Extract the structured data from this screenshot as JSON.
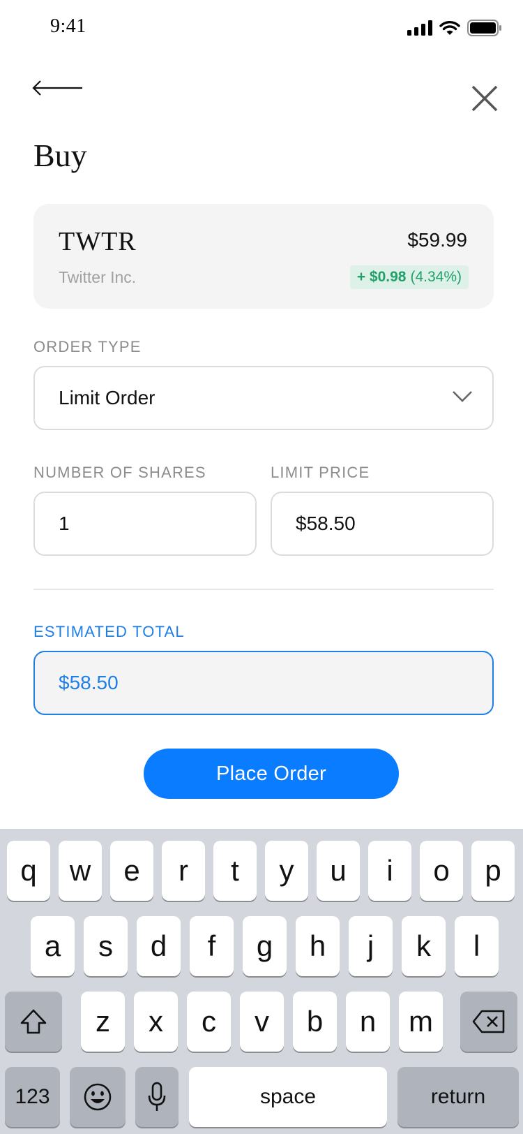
{
  "status_bar": {
    "time": "9:41"
  },
  "header": {
    "title": "Buy"
  },
  "stock": {
    "ticker": "TWTR",
    "company": "Twitter Inc.",
    "price": "$59.99",
    "change_amount": "+ $0.98",
    "change_percent": "(4.34%)"
  },
  "order_type": {
    "label": "ORDER TYPE",
    "value": "Limit Order"
  },
  "shares": {
    "label": "NUMBER OF SHARES",
    "value": "1"
  },
  "limit_price": {
    "label": "LIMIT PRICE",
    "value": "$58.50"
  },
  "estimated_total": {
    "label": "ESTIMATED TOTAL",
    "value": "$58.50"
  },
  "place_order": {
    "label": "Place Order"
  },
  "keyboard": {
    "row1": [
      "q",
      "w",
      "e",
      "r",
      "t",
      "y",
      "u",
      "i",
      "o",
      "p"
    ],
    "row2": [
      "a",
      "s",
      "d",
      "f",
      "g",
      "h",
      "j",
      "k",
      "l"
    ],
    "row3": [
      "z",
      "x",
      "c",
      "v",
      "b",
      "n",
      "m"
    ],
    "numbers_key": "123",
    "space_key": "space",
    "return_key": "return"
  },
  "colors": {
    "accent": "#0a7cff",
    "positive": "#21a06a",
    "positive_bg": "#ddf1e8",
    "estimate_blue": "#1e7fe6",
    "keyboard_bg": "#d3d6dc"
  }
}
